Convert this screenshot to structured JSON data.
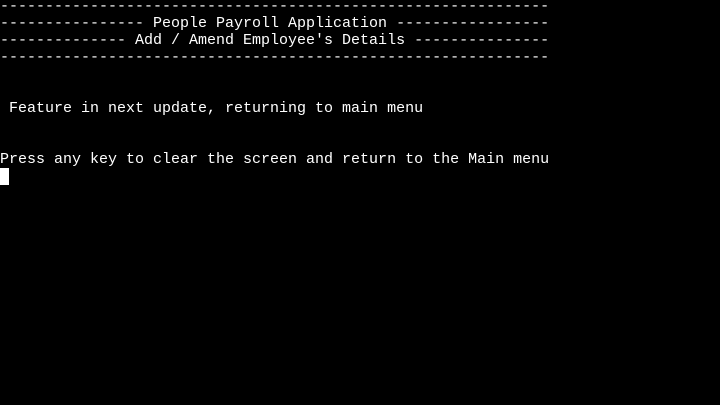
{
  "terminal": {
    "rule_top": "-------------------------------------------------------------",
    "app_title_line": "---------------- People Payroll Application -----------------",
    "section_title_line": "-------------- Add / Amend Employee's Details ---------------",
    "rule_bottom": "-------------------------------------------------------------",
    "message": " Feature in next update, returning to main menu",
    "prompt": "Press any key to clear the screen and return to the Main menu"
  },
  "colors": {
    "background": "#000000",
    "text": "#ffffff"
  }
}
